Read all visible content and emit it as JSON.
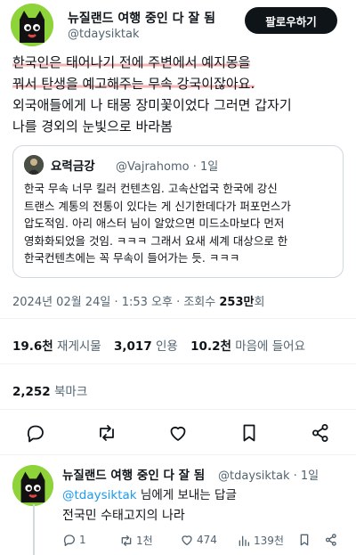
{
  "author": {
    "name": "뉴질랜드 여행 중인 다 잘 됨",
    "handle": "@tdaysiktak",
    "follow_label": "팔로우하기"
  },
  "tweet": {
    "lines": [
      "한국인은 태어나기 전에 주변에서 예지몽을",
      "꿔서 탄생을 예고해주는 무속 강국이잖아요.",
      "외국애들에게 나 태몽 장미꽃이었다 그러면 갑자기",
      "나를 경외의 눈빛으로 바라봄"
    ]
  },
  "quote": {
    "name": "요력금강",
    "handle": "@Vajrahomo · 1일",
    "lines": [
      "한국 무속 너무 킬러 컨텐츠임. 고속산업국 한국에 강신",
      "트랜스 계통의 전통이 있다는 게 신기한데다가 퍼포먼스가",
      "압도적임. 아리 애스터 님이 알았으면 미드소마보다 먼저",
      "영화화되었을 것임. ㅋㅋㅋ 그래서 요새 세계 대상으로 한",
      "한국컨텐츠에는 꼭 무속이 들어가는 듯. ㅋㅋㅋ"
    ]
  },
  "meta": {
    "datetime": "2024년 02월 24일 · 1:53 오후 · 조회수 ",
    "views": "253만",
    "views_suffix": "회"
  },
  "stats": {
    "retweets": "19.6천",
    "retweets_label": "재게시물",
    "quotes": "3,017",
    "quotes_label": "인용",
    "likes": "10.2천",
    "likes_label": "마음에 들어요",
    "bookmarks": "2,252",
    "bookmarks_label": "북마크"
  },
  "actions": [
    "reply-icon",
    "retweet-icon",
    "like-icon",
    "bookmark-icon",
    "share-icon"
  ],
  "reply": {
    "name": "뉴질랜드 여행 중인 다 잘 됨",
    "handle": "@tdaysiktak · 1일",
    "mention": "@tdaysiktak",
    "to_suffix": " 님에게 보내는 답글",
    "text": "전국민 수태고지의 나라",
    "replies": "1",
    "retweets": "1천",
    "likes": "474",
    "views": "139천"
  },
  "colors": {
    "accent": "#1d9bf0",
    "highlight": "#f6b3b3",
    "avatar_bg": "#8fd33a"
  }
}
